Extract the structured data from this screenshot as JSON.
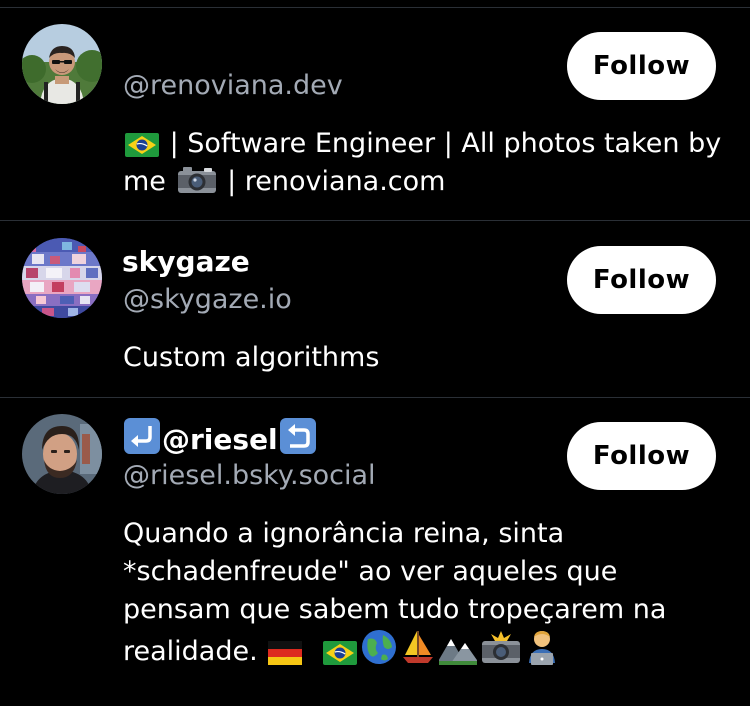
{
  "profiles": [
    {
      "display_name": "",
      "handle": "@renoviana.dev",
      "follow_label": "Follow",
      "bio_parts": [
        "| Software Engineer | All photos taken by me",
        "| renoviana.com"
      ],
      "bio_icons": [
        "brazil-flag-icon",
        "camera-icon"
      ]
    },
    {
      "display_name": "skygaze",
      "handle": "@skygaze.io",
      "follow_label": "Follow",
      "bio_parts": [
        "Custom algorithms"
      ]
    },
    {
      "display_name": "@riesel",
      "display_name_icons": [
        "left-hook-arrow-icon",
        "right-hook-arrow-icon"
      ],
      "handle": "@riesel.bsky.social",
      "follow_label": "Follow",
      "bio_parts": [
        "Quando a ignorância reina, sinta *schadenfreude\" ao ver aqueles que pensam que sabem tudo tropeçarem na realidade."
      ],
      "bio_icons": [
        "germany-flag-icon",
        "brazil-flag-icon",
        "globe-icon",
        "sailboat-icon",
        "mountain-icon",
        "camera-flash-icon",
        "technologist-icon"
      ]
    }
  ],
  "colors": {
    "background": "#000000",
    "text": "#ffffff",
    "handle": "#a3aab5",
    "divider": "#2a2f36",
    "button_bg": "#ffffff",
    "button_text": "#000000"
  }
}
